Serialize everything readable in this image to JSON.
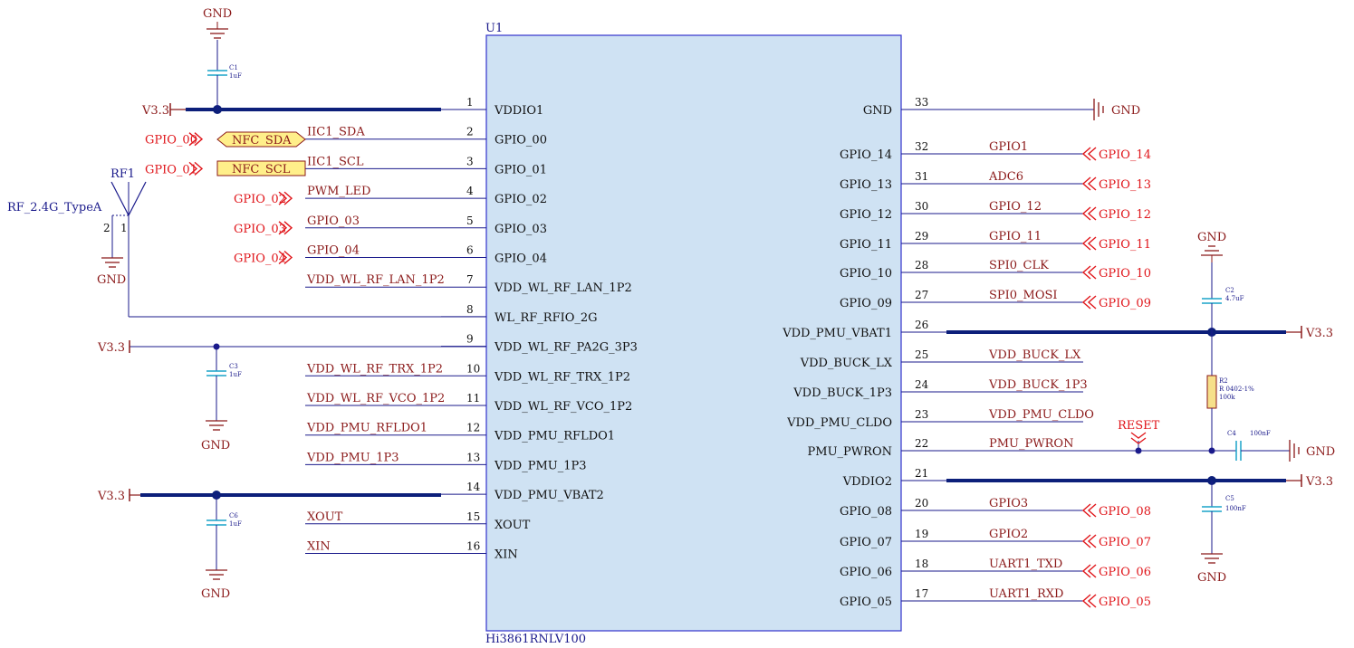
{
  "chip": {
    "designator": "U1",
    "part": "Hi3861RNLV100",
    "left_pins": [
      {
        "num": "1",
        "name": "VDDIO1",
        "net": "",
        "port": ""
      },
      {
        "num": "2",
        "name": "GPIO_00",
        "net": "IIC1_SDA",
        "port": "GPIO_00"
      },
      {
        "num": "3",
        "name": "GPIO_01",
        "net": "IIC1_SCL",
        "port": "GPIO_01"
      },
      {
        "num": "4",
        "name": "GPIO_02",
        "net": "PWM_LED",
        "port": "GPIO_02"
      },
      {
        "num": "5",
        "name": "GPIO_03",
        "net": "GPIO_03",
        "port": "GPIO_03"
      },
      {
        "num": "6",
        "name": "GPIO_04",
        "net": "GPIO_04",
        "port": "GPIO_04"
      },
      {
        "num": "7",
        "name": "VDD_WL_RF_LAN_1P2",
        "net": "VDD_WL_RF_LAN_1P2",
        "port": ""
      },
      {
        "num": "8",
        "name": "WL_RF_RFIO_2G",
        "net": "",
        "port": ""
      },
      {
        "num": "9",
        "name": "VDD_WL_RF_PA2G_3P3",
        "net": "",
        "port": ""
      },
      {
        "num": "10",
        "name": "VDD_WL_RF_TRX_1P2",
        "net": "VDD_WL_RF_TRX_1P2",
        "port": ""
      },
      {
        "num": "11",
        "name": "VDD_WL_RF_VCO_1P2",
        "net": "VDD_WL_RF_VCO_1P2",
        "port": ""
      },
      {
        "num": "12",
        "name": "VDD_PMU_RFLDO1",
        "net": "VDD_PMU_RFLDO1",
        "port": ""
      },
      {
        "num": "13",
        "name": "VDD_PMU_1P3",
        "net": "VDD_PMU_1P3",
        "port": ""
      },
      {
        "num": "14",
        "name": "VDD_PMU_VBAT2",
        "net": "",
        "port": ""
      },
      {
        "num": "15",
        "name": "XOUT",
        "net": "XOUT",
        "port": ""
      },
      {
        "num": "16",
        "name": "XIN",
        "net": "XIN",
        "port": ""
      }
    ],
    "right_pins": [
      {
        "num": "33",
        "name": "GND",
        "net": "",
        "port": ""
      },
      {
        "num": "32",
        "name": "GPIO_14",
        "net": "GPIO1",
        "port": "GPIO_14"
      },
      {
        "num": "31",
        "name": "GPIO_13",
        "net": "ADC6",
        "port": "GPIO_13"
      },
      {
        "num": "30",
        "name": "GPIO_12",
        "net": "GPIO_12",
        "port": "GPIO_12"
      },
      {
        "num": "29",
        "name": "GPIO_11",
        "net": "GPIO_11",
        "port": "GPIO_11"
      },
      {
        "num": "28",
        "name": "GPIO_10",
        "net": "SPI0_CLK",
        "port": "GPIO_10"
      },
      {
        "num": "27",
        "name": "GPIO_09",
        "net": "SPI0_MOSI",
        "port": "GPIO_09"
      },
      {
        "num": "26",
        "name": "VDD_PMU_VBAT1",
        "net": "",
        "port": ""
      },
      {
        "num": "25",
        "name": "VDD_BUCK_LX",
        "net": "VDD_BUCK_LX",
        "port": ""
      },
      {
        "num": "24",
        "name": "VDD_BUCK_1P3",
        "net": "VDD_BUCK_1P3",
        "port": ""
      },
      {
        "num": "23",
        "name": "VDD_PMU_CLDO",
        "net": "VDD_PMU_CLDO",
        "port": ""
      },
      {
        "num": "22",
        "name": "PMU_PWRON",
        "net": "PMU_PWRON",
        "port": ""
      },
      {
        "num": "21",
        "name": "VDDIO2",
        "net": "",
        "port": ""
      },
      {
        "num": "20",
        "name": "GPIO_08",
        "net": "GPIO3",
        "port": "GPIO_08"
      },
      {
        "num": "19",
        "name": "GPIO_07",
        "net": "GPIO2",
        "port": "GPIO_07"
      },
      {
        "num": "18",
        "name": "GPIO_06",
        "net": "UART1_TXD",
        "port": "GPIO_06"
      },
      {
        "num": "17",
        "name": "GPIO_05",
        "net": "UART1_RXD",
        "port": "GPIO_05"
      }
    ]
  },
  "nfc": {
    "sda": "NFC_SDA",
    "scl": "NFC_SCL"
  },
  "antenna": {
    "ref": "RF1",
    "type": "RF_2.4G_TypeA",
    "pin1": "1",
    "pin2": "2"
  },
  "power": {
    "v33": "V3.3",
    "gnd": "GND"
  },
  "caps": {
    "c1": {
      "ref": "C1",
      "value": "1uF"
    },
    "c3": {
      "ref": "C3",
      "value": "1uF"
    },
    "c6": {
      "ref": "C6",
      "value": "1uF"
    },
    "c2": {
      "ref": "C2",
      "value": "4.7uF"
    },
    "c4": {
      "ref": "C4",
      "value": "100nF"
    },
    "c5": {
      "ref": "C5",
      "value": "100nF"
    }
  },
  "r2": {
    "ref": "R2",
    "footprint": "R 0402-1%",
    "value": "100k"
  },
  "reset": {
    "label": "RESET"
  },
  "colors": {
    "body_fill": "#cfe2f3",
    "body_stroke": "#3333cc",
    "wire": "#1a1a8b",
    "bus": "#0c1f7a",
    "power": "#8b1a1a",
    "port": "#e0161b",
    "nfc_fill": "#ffef8a"
  }
}
